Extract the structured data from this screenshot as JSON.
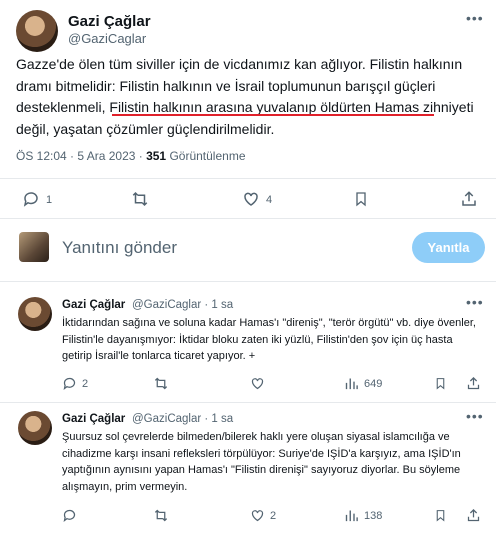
{
  "main_tweet": {
    "author_name": "Gazi Çağlar",
    "author_handle": "@GaziCaglar",
    "text_part1": "Gazze'de ölen tüm siviller için de vicdanımız kan ağlıyor. Filistin halkının dramı bitmelidir: Filistin halkının ve İsrail toplumunun barışçıl güçleri desteklenmeli, ",
    "text_underlined": "Filistin halkının arasına yuvalanıp öldürten Hamas",
    "text_part2": " zihniyeti değil, yaşatan çözümler güçlendirilmelidir.",
    "timestamp": "ÖS 12:04 · 5 Ara 2023 · ",
    "views_count": "351",
    "views_label": " Görüntülenme",
    "actions": {
      "reply_count": "1",
      "retweet_count": "",
      "like_count": "4"
    }
  },
  "composer": {
    "placeholder": "Yanıtını gönder",
    "reply_button": "Yanıtla"
  },
  "replies": [
    {
      "author_name": "Gazi Çağlar",
      "handle_time": "@GaziCaglar · 1 sa",
      "text": "İktidarından sağına ve soluna kadar Hamas'ı \"direniş\", \"terör örgütü\" vb. diye övenler, Filistin'le dayanışmıyor: İktidar bloku zaten iki yüzlü, Filistin'den şov için üç hasta getirip İsrail'le tonlarca ticaret yapıyor. +",
      "reply_count": "2",
      "like_count": "",
      "views_count": "649"
    },
    {
      "author_name": "Gazi Çağlar",
      "handle_time": "@GaziCaglar · 1 sa",
      "text": "Şuursuz sol çevrelerde bilmeden/bilerek haklı yere oluşan siyasal islamcılığa ve cihadizme karşı insani refleksleri törpülüyor: Suriye'de IŞİD'a karşıyız, ama IŞİD'ın yaptığının aynısını yapan Hamas'ı \"Filistin direnişi\" sayıyoruz diyorlar. Bu söyleme alışmayın, prim vermeyin.",
      "reply_count": "",
      "like_count": "2",
      "views_count": "138"
    }
  ],
  "colors": {
    "accent": "#1d9bf0",
    "reply_button_disabled": "#8ecdf8",
    "underline": "#e0202a",
    "muted": "#536471"
  }
}
